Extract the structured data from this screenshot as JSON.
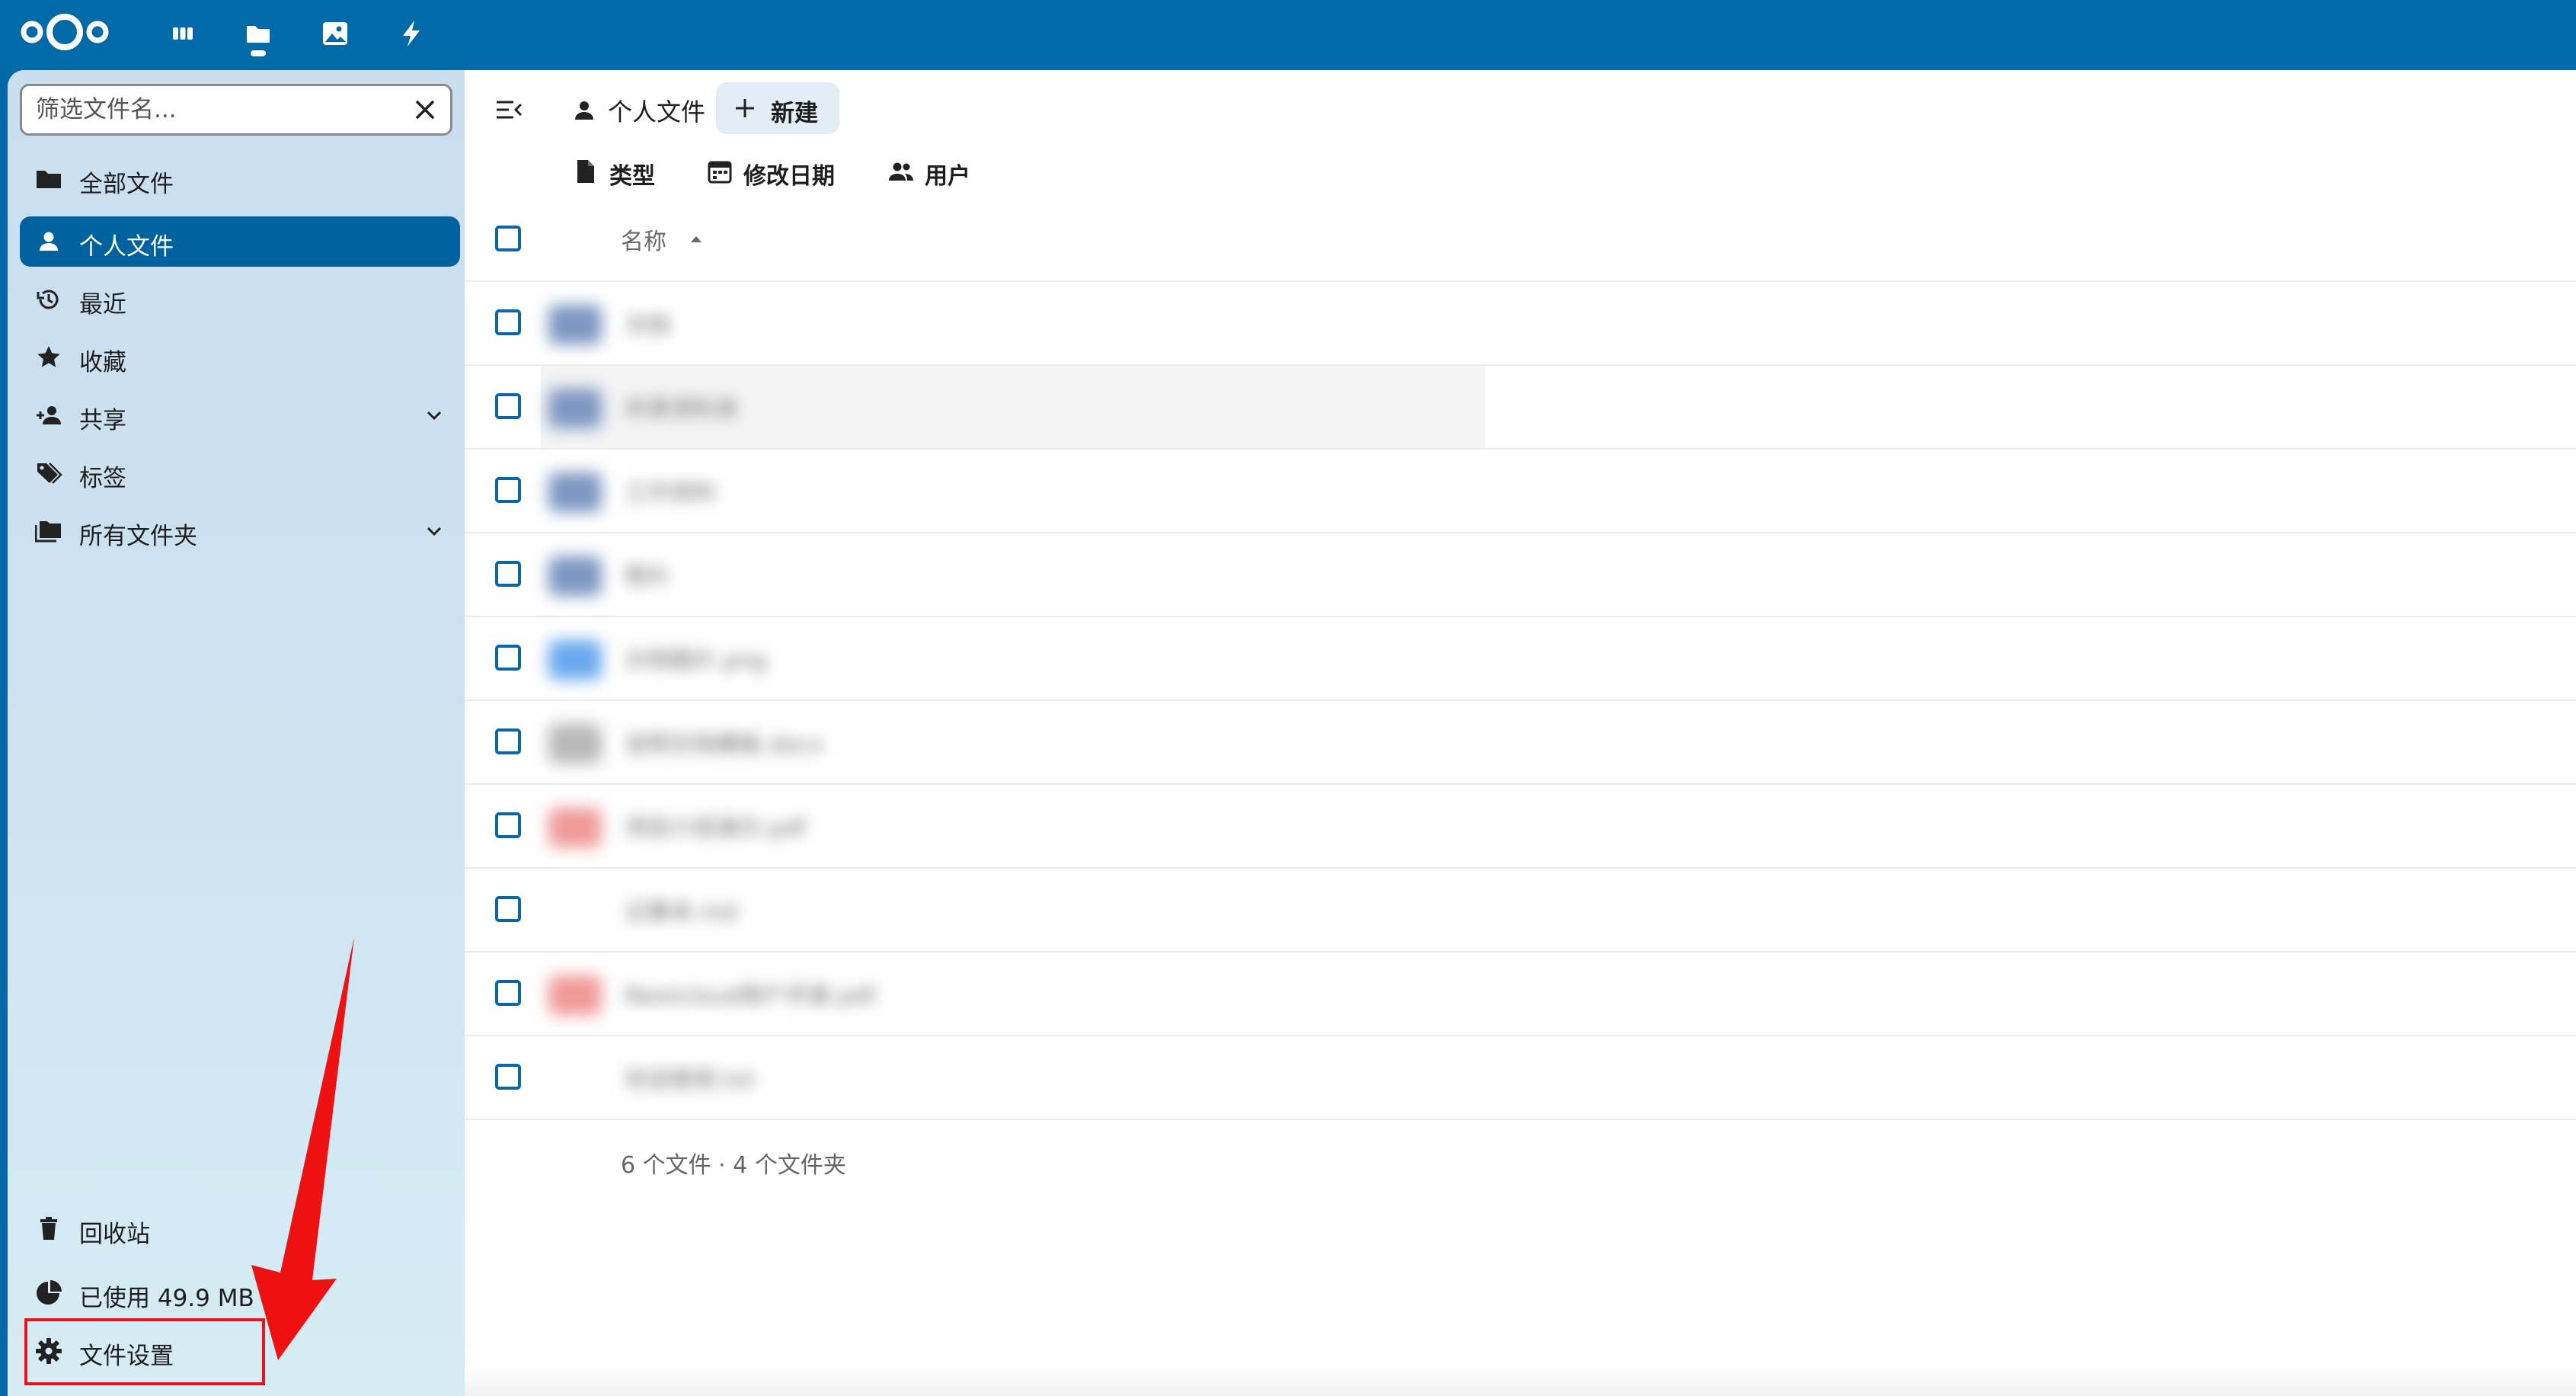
{
  "header": {
    "apps": [
      {
        "name": "dashboard",
        "icon": "dashboard-icon"
      },
      {
        "name": "files",
        "icon": "folder-icon",
        "active": true
      },
      {
        "name": "photos",
        "icon": "image-icon"
      },
      {
        "name": "activity",
        "icon": "lightning-icon"
      }
    ],
    "colors": {
      "header_bg": "#0069a8",
      "accent": "#00629f"
    }
  },
  "sidebar": {
    "filter": {
      "placeholder": "筛选文件名..."
    },
    "items": [
      {
        "label": "全部文件",
        "icon": "folder-icon"
      },
      {
        "label": "个人文件",
        "icon": "user-icon",
        "active": true
      },
      {
        "label": "最近",
        "icon": "history-icon"
      },
      {
        "label": "收藏",
        "icon": "star-icon"
      },
      {
        "label": "共享",
        "icon": "share-user-icon",
        "expandable": true
      },
      {
        "label": "标签",
        "icon": "tag-icon"
      },
      {
        "label": "所有文件夹",
        "icon": "folders-icon",
        "expandable": true
      }
    ],
    "bottom": {
      "trash": "回收站",
      "quota": "已使用 49.9 MB",
      "settings": "文件设置"
    }
  },
  "main": {
    "breadcrumb": {
      "label": "个人文件"
    },
    "new_button": {
      "label": "新建"
    },
    "filters": [
      {
        "label": "类型",
        "icon": "file-icon"
      },
      {
        "label": "修改日期",
        "icon": "calendar-icon"
      },
      {
        "label": "用户",
        "icon": "users-icon"
      }
    ],
    "columns": {
      "name": "名称"
    },
    "files": [
      {
        "name": "文档",
        "icon_color": "#7c97c2"
      },
      {
        "name": "共享资料夹",
        "icon_color": "#7c97c2"
      },
      {
        "name": "工作资料",
        "icon_color": "#7c97c2"
      },
      {
        "name": "照片",
        "icon_color": "#7c97c2"
      },
      {
        "name": "示例图片.png",
        "icon_color": "#6aa8ee"
      },
      {
        "name": "说明文档模板.docx",
        "icon_color": "#b9b9b9"
      },
      {
        "name": "项目介绍演示.pdf",
        "icon_color": "#f09a9a"
      },
      {
        "name": "记事本.md",
        "icon_color": "#ffffff"
      },
      {
        "name": "Nextcloud用户手册.pdf",
        "icon_color": "#f09a9a"
      },
      {
        "name": "欢迎使用.txt",
        "icon_color": "#ffffff"
      }
    ],
    "summary": "6 个文件 · 4 个文件夹"
  }
}
